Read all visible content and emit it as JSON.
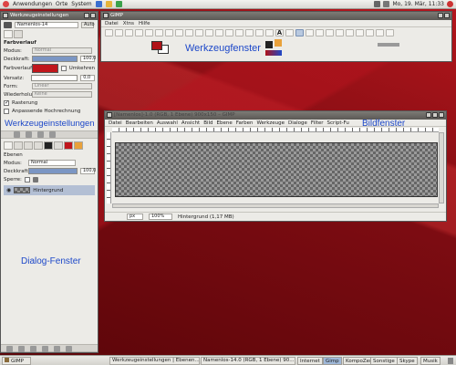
{
  "top_panel": {
    "menus": [
      "Anwendungen",
      "Orte",
      "System"
    ],
    "clock": "Mo, 19. Mär, 11:33"
  },
  "toolbox_window": {
    "title": "GIMP",
    "menus": [
      "Datei",
      "Xtns",
      "Hilfe"
    ],
    "label": "Werkzeugfenster"
  },
  "tool_options_window": {
    "title": "Werkzeugeinstellungen",
    "brush": "Namenlos-14",
    "auto_button": "Auto",
    "section": "Farbverlauf",
    "modus_label": "Modus:",
    "modus_value": "Normal",
    "deckkraft_label": "Deckkraft:",
    "deckkraft_value": "100,0",
    "farbverlauf_label": "Farbverlauf:",
    "umkehren_label": "Umkehren",
    "versatz_label": "Versatz:",
    "versatz_value": "0,0",
    "form_label": "Form:",
    "form_value": "Linear",
    "wiederholung_label": "Wiederholung:",
    "wiederholung_value": "Keine",
    "rasterung_label": "Rasterung",
    "hochrechnung_label": "Anpassende Hochrechnung",
    "label": "Werkzeugeinstellungen"
  },
  "layers_panel": {
    "title": "Ebenen",
    "modus_label": "Modus:",
    "modus_value": "Normal",
    "deckkraft_label": "Deckkraft:",
    "deckkraft_value": "100,0",
    "sperre_label": "Sperre:",
    "layer_name": "Hintergrund",
    "label": "Dialog-Fenster"
  },
  "image_window": {
    "title": "[Namenlos]-1.0 (RGB, 1 Ebene) 900x150 – GIMP",
    "menus": [
      "Datei",
      "Bearbeiten",
      "Auswahl",
      "Ansicht",
      "Bild",
      "Ebene",
      "Farben",
      "Werkzeuge",
      "Dialoge",
      "Filter",
      "Script-Fu"
    ],
    "label": "Bildfenster",
    "unit": "px",
    "zoom": "100%",
    "status": "Hintergrund (1,17 MB)"
  },
  "taskbar": {
    "gimp": "GIMP",
    "task1": "Werkzeugeinstellungen | Ebenen...",
    "task2": "Namenlos-14.0 (RGB, 1 Ebene) 90...",
    "workspaces": [
      "Internet",
      "Gimp",
      "KompoZer",
      "Sonstige",
      "Skype",
      "Musik"
    ]
  },
  "colors": {
    "foreground": "#b01218",
    "background": "#ffffff",
    "label_blue": "#1d48c9"
  }
}
